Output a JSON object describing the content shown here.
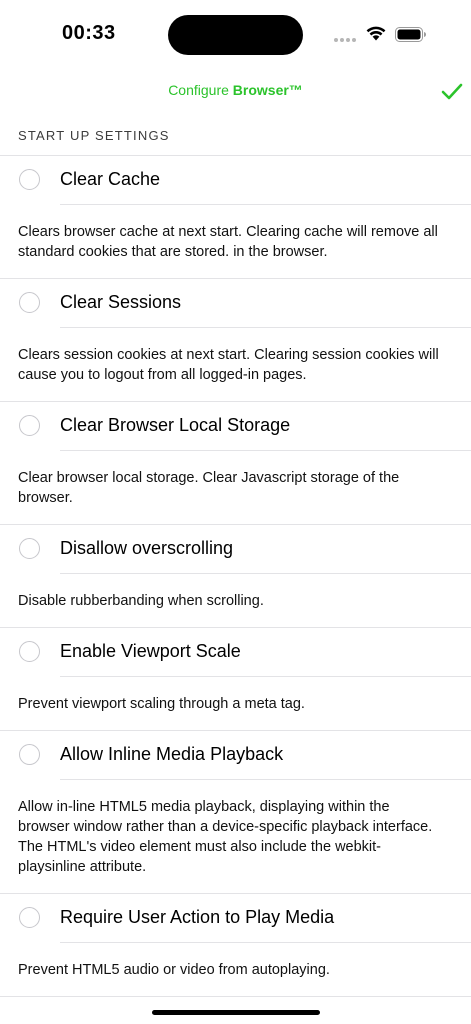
{
  "status_bar": {
    "time": "00:33",
    "wifi_icon": "wifi-icon",
    "battery_icon": "battery-full-icon"
  },
  "nav": {
    "title_prefix": "Configure ",
    "title_brand": "Browser™",
    "done_icon": "checkmark-icon",
    "accent_color": "#2bc32b"
  },
  "section": {
    "header": "START UP SETTINGS"
  },
  "settings": [
    {
      "label": "Clear Cache",
      "checked": false,
      "description": "Clears browser cache at next start. Clearing cache will remove all standard cookies that are stored. in the browser."
    },
    {
      "label": "Clear Sessions",
      "checked": false,
      "description": "Clears session cookies at next start. Clearing session cookies will cause you to logout from all logged-in pages."
    },
    {
      "label": "Clear Browser Local Storage",
      "checked": false,
      "description": "Clear browser local storage. Clear Javascript storage of the browser."
    },
    {
      "label": "Disallow overscrolling",
      "checked": false,
      "description": "Disable rubberbanding when scrolling."
    },
    {
      "label": "Enable Viewport Scale",
      "checked": false,
      "description": "Prevent viewport scaling through a meta tag."
    },
    {
      "label": "Allow Inline Media Playback",
      "checked": false,
      "description": "Allow in-line HTML5 media playback, displaying within the browser window rather than a device-specific playback interface. The HTML's video element must also include the webkit-playsinline attribute."
    },
    {
      "label": "Require User Action to Play Media",
      "checked": false,
      "description": "Prevent HTML5 audio or video from autoplaying."
    }
  ]
}
